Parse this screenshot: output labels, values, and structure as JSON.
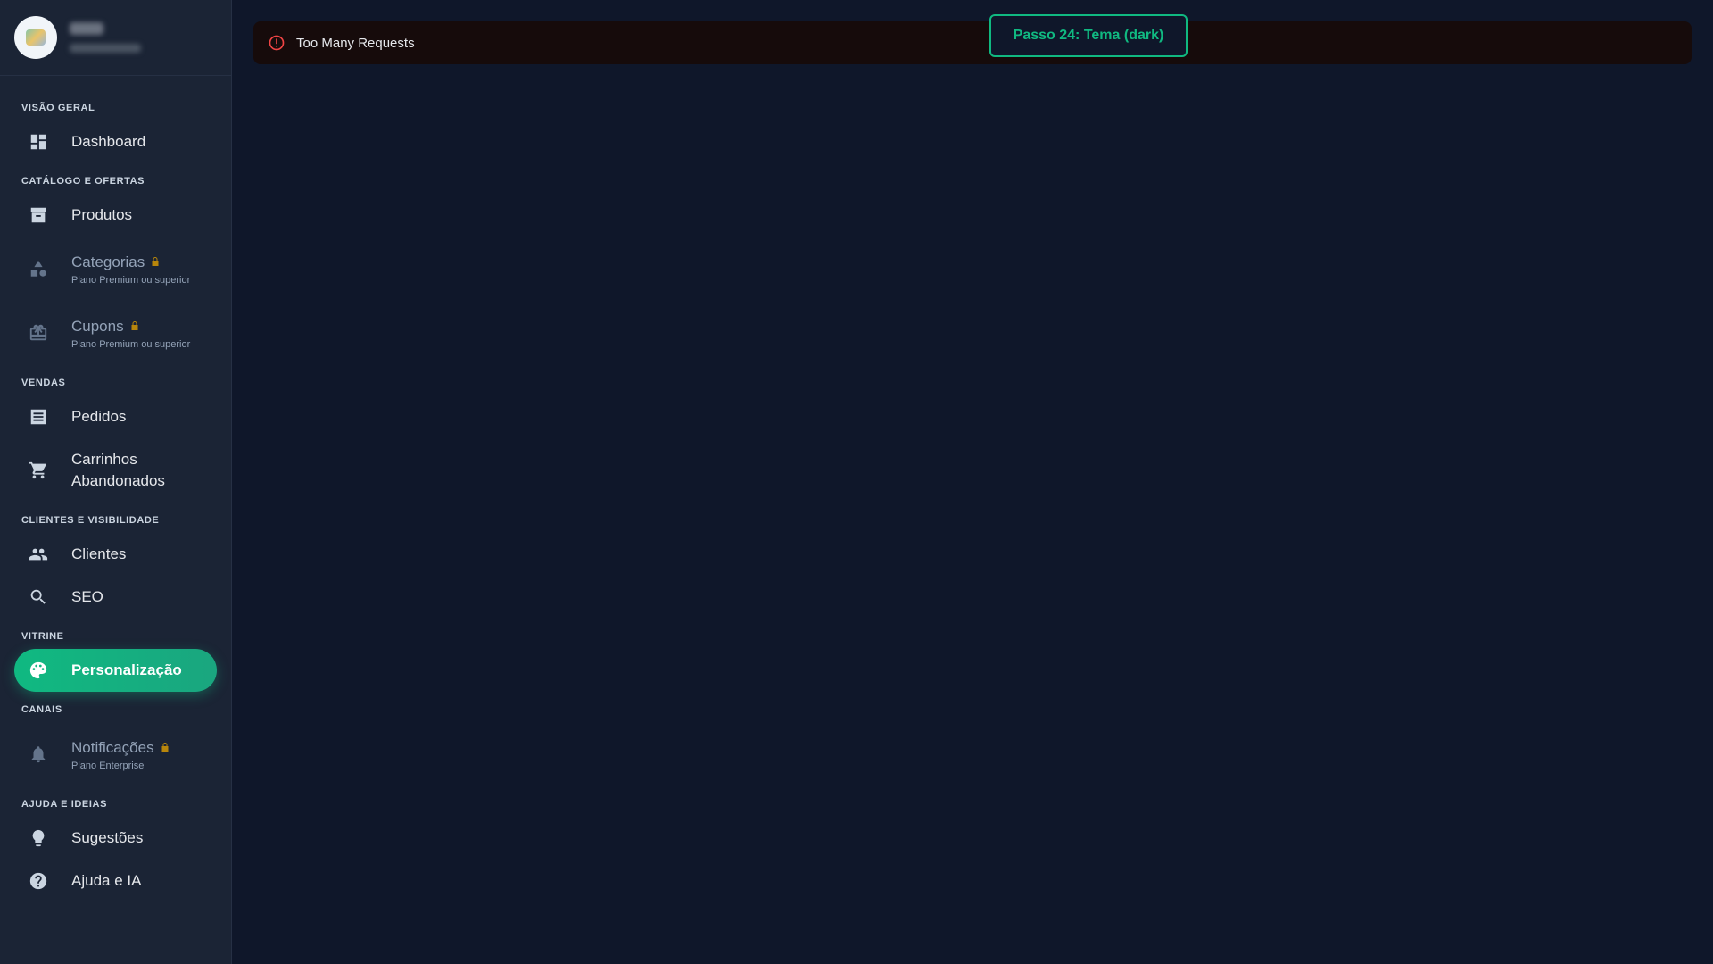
{
  "brand": {
    "name": "",
    "subtitle": ""
  },
  "sections": [
    {
      "label": "VISÃO GERAL",
      "items": [
        {
          "label": "Dashboard",
          "icon": "dashboard-icon"
        }
      ]
    },
    {
      "label": "CATÁLOGO E OFERTAS",
      "items": [
        {
          "label": "Produtos",
          "icon": "archive-icon"
        },
        {
          "label": "Categorias",
          "icon": "category-icon",
          "locked": true,
          "sub": "Plano Premium ou superior"
        },
        {
          "label": "Cupons",
          "icon": "coupon-icon",
          "locked": true,
          "sub": "Plano Premium ou superior"
        }
      ]
    },
    {
      "label": "VENDAS",
      "items": [
        {
          "label": "Pedidos",
          "icon": "list-icon"
        },
        {
          "label": "Carrinhos Abandonados",
          "icon": "cart-icon"
        }
      ]
    },
    {
      "label": "CLIENTES E VISIBILIDADE",
      "items": [
        {
          "label": "Clientes",
          "icon": "people-icon"
        },
        {
          "label": "SEO",
          "icon": "search-icon"
        }
      ]
    },
    {
      "label": "VITRINE",
      "items": [
        {
          "label": "Personalização",
          "icon": "palette-icon",
          "active": true
        }
      ]
    },
    {
      "label": "CANAIS",
      "items": [
        {
          "label": "Notificações",
          "icon": "bell-icon",
          "locked": true,
          "sub": "Plano Enterprise"
        }
      ]
    },
    {
      "label": "AJUDA E IDEIAS",
      "items": [
        {
          "label": "Sugestões",
          "icon": "lightbulb-icon"
        },
        {
          "label": "Ajuda e IA",
          "icon": "help-icon"
        }
      ]
    }
  ],
  "error": {
    "message": "Too Many Requests"
  },
  "step_badge": {
    "label": "Passo 24: Tema (dark)"
  },
  "colors": {
    "accent": "#10b981",
    "error": "#ef4444",
    "sidebar_bg": "#1b2435",
    "main_bg": "#0f172a"
  }
}
